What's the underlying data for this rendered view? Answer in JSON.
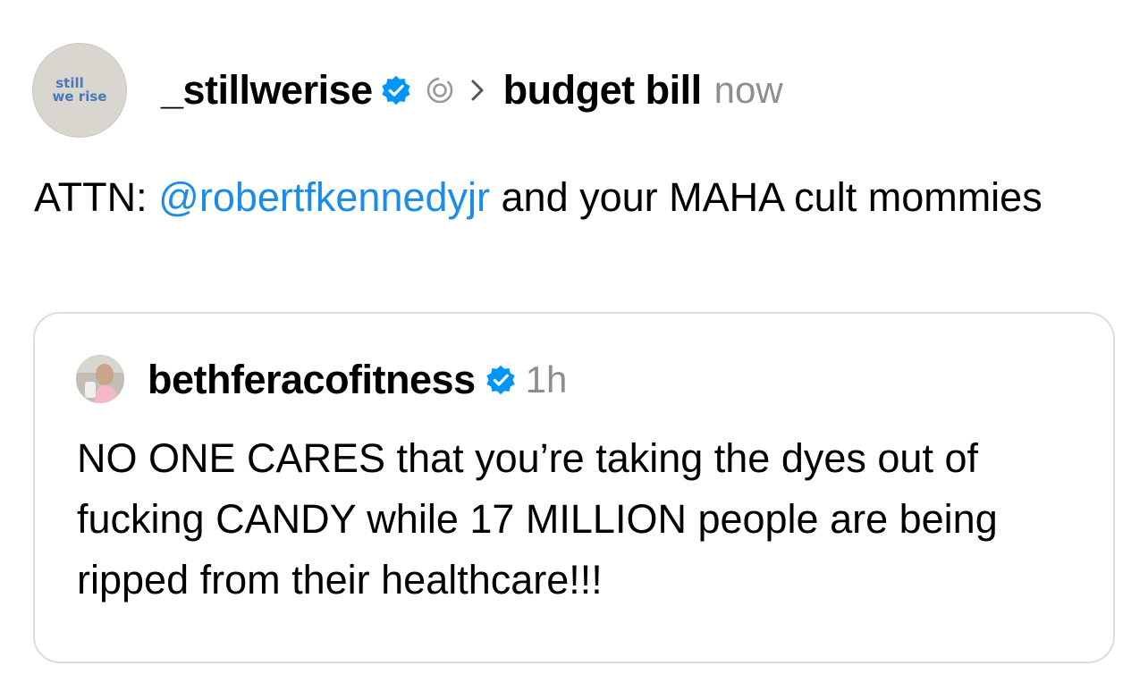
{
  "post": {
    "avatar_text_line1": "still",
    "avatar_text_line2": "we rise",
    "username": "_stillwerise",
    "verified_icon": "verified-badge-icon",
    "topic_icon": "threads-topic-icon",
    "topic": "budget bill",
    "time": "now",
    "text_prefix": "ATTN: ",
    "mention": "@robertfkennedyjr",
    "text_suffix": " and your MAHA cult mommies"
  },
  "quote": {
    "username": "bethferacofitness",
    "verified_icon": "verified-badge-icon",
    "time": "1h",
    "text": "NO ONE CARES that you’re taking the dyes out of fucking CANDY while 17 MILLION people are being ripped from their healthcare!!!"
  },
  "colors": {
    "mention": "#1d8ce8",
    "verified": "#0095f6",
    "meta_gray": "#8e8e8e",
    "card_border": "#dcdcdc"
  }
}
